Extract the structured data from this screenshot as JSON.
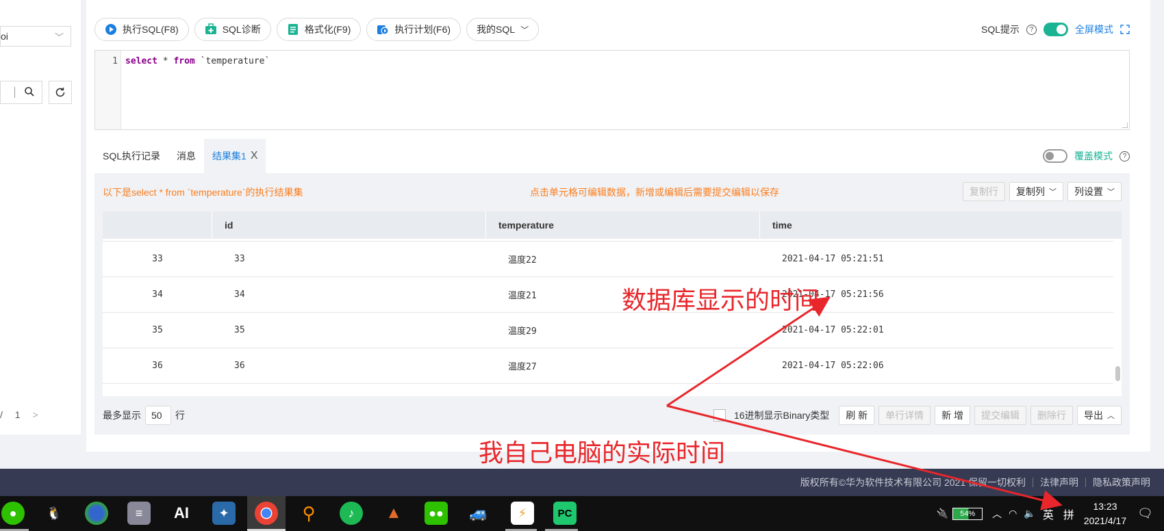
{
  "left": {
    "select_value": "oi",
    "pager": {
      "slash": "/",
      "total": "1"
    }
  },
  "toolbar": {
    "buttons": [
      {
        "label": "执行SQL(F8)",
        "icon": "play-icon",
        "color": "#1a7fe0"
      },
      {
        "label": "SQL诊断",
        "icon": "medkit-icon",
        "color": "#1ab394"
      },
      {
        "label": "格式化(F9)",
        "icon": "format-doc-icon",
        "color": "#1ab394"
      },
      {
        "label": "执行计划(F6)",
        "icon": "plan-icon",
        "color": "#1a7fe0"
      },
      {
        "label": "我的SQL",
        "icon": "chevron-down-icon"
      }
    ],
    "sql_hint_label": "SQL提示",
    "fullscreen_label": "全屏模式"
  },
  "editor": {
    "line_number": "1",
    "code": {
      "kw1": "select",
      "mid": " * ",
      "kw2": "from",
      "table": " `temperature`"
    }
  },
  "tabs": [
    {
      "label": "SQL执行记录"
    },
    {
      "label": "消息"
    },
    {
      "label": "结果集1",
      "close": "X"
    }
  ],
  "cover_mode_label": "覆盖模式",
  "result": {
    "info_left": "以下是select * from `temperature`的执行结果集",
    "info_mid": "点击单元格可编辑数据，新增或编辑后需要提交编辑以保存",
    "buttons": {
      "copy_row": "复制行",
      "copy_col": "复制列",
      "col_settings": "列设置"
    },
    "columns": [
      "",
      "id",
      "temperature",
      "time"
    ],
    "rows": [
      {
        "n": "33",
        "id": "33",
        "temperature": "温度22",
        "time": "2021-04-17 05:21:51"
      },
      {
        "n": "34",
        "id": "34",
        "temperature": "温度21",
        "time": "2021-04-17 05:21:56"
      },
      {
        "n": "35",
        "id": "35",
        "temperature": "温度29",
        "time": "2021-04-17 05:22:01"
      },
      {
        "n": "36",
        "id": "36",
        "temperature": "温度27",
        "time": "2021-04-17 05:22:06"
      }
    ],
    "footer": {
      "max_show_label": "最多显示",
      "max_show_value": "50",
      "row_unit": "行",
      "hex_label": "16进制显示Binary类型",
      "refresh": "刷 新",
      "row_detail": "单行详情",
      "add": "新 增",
      "submit": "提交编辑",
      "delete_row": "删除行",
      "export": "导出"
    }
  },
  "footer_bar": {
    "copyright": "版权所有©华为软件技术有限公司 2021 保留一切权利",
    "legal": "法律声明",
    "privacy": "隐私政策声明"
  },
  "taskbar": {
    "battery": "54%",
    "ime": "英",
    "time": "13:23",
    "date": "2021/4/17"
  },
  "annotations": {
    "db_time": "数据库显示的时间",
    "pc_time": "我自己电脑的实际时间",
    "color": "#e8262b"
  }
}
